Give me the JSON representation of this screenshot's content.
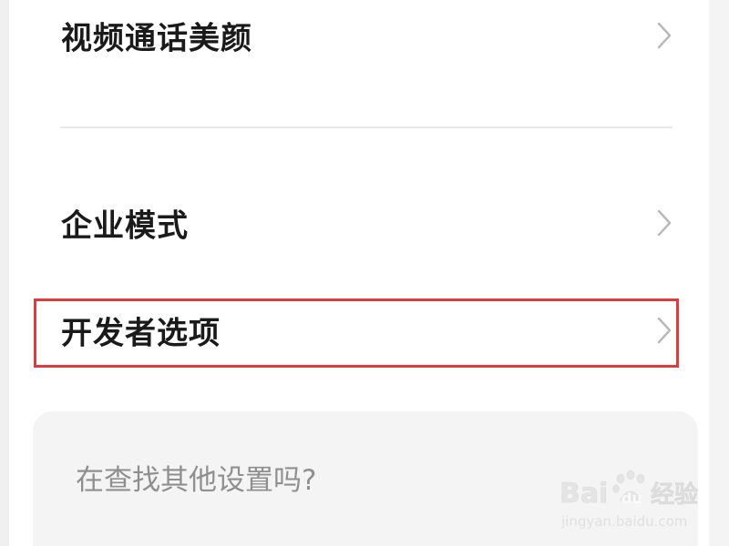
{
  "settings_list": {
    "items": [
      {
        "label": "视频通话美颜"
      },
      {
        "label": "企业模式"
      },
      {
        "label": "开发者选项"
      }
    ]
  },
  "suggestion_card": {
    "prompt": "在查找其他设置吗?"
  },
  "colors": {
    "highlight_border": "#e0393e",
    "text_primary": "#1a1a1a",
    "text_secondary": "#8f8f8f",
    "chevron": "#b8b8b8",
    "card_background": "#f4f4f4"
  },
  "icons": {
    "row_chevron": "chevron-right-icon"
  },
  "watermark": {
    "logo_text": "Bai du 经验",
    "site_text": "jingyan.baidu.com"
  }
}
